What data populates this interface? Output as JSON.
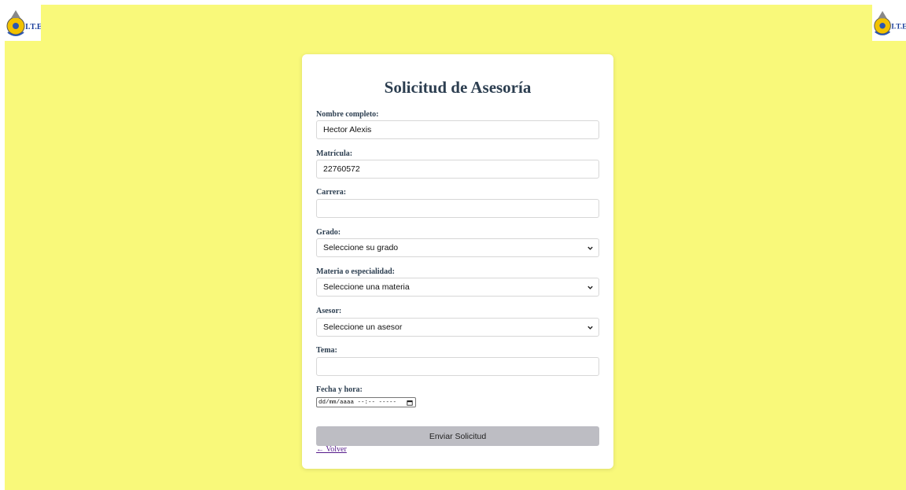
{
  "logo": {
    "icon": "ite-logo-icon",
    "text": "I.T.E."
  },
  "form": {
    "title": "Solicitud de Asesoría",
    "fields": {
      "nombre": {
        "label": "Nombre completo:",
        "value": "Hector Alexis"
      },
      "matricula": {
        "label": "Matrícula:",
        "value": "22760572"
      },
      "carrera": {
        "label": "Carrera:",
        "value": ""
      },
      "grado": {
        "label": "Grado:",
        "selected": "Seleccione su grado"
      },
      "materia": {
        "label": "Materia o especialidad:",
        "selected": "Seleccione una materia"
      },
      "asesor": {
        "label": "Asesor:",
        "selected": "Seleccione un asesor"
      },
      "tema": {
        "label": "Tema:",
        "value": ""
      },
      "fecha": {
        "label": "Fecha y hora:",
        "placeholder": "dd/mm/aaaa --:-- -----"
      }
    },
    "submit_label": "Enviar Solicitud",
    "back_label": "← Volver"
  },
  "colors": {
    "background": "#f9f97a",
    "title": "#2c3e50",
    "submit": "#bdbdc3",
    "link": "#551a8b"
  }
}
